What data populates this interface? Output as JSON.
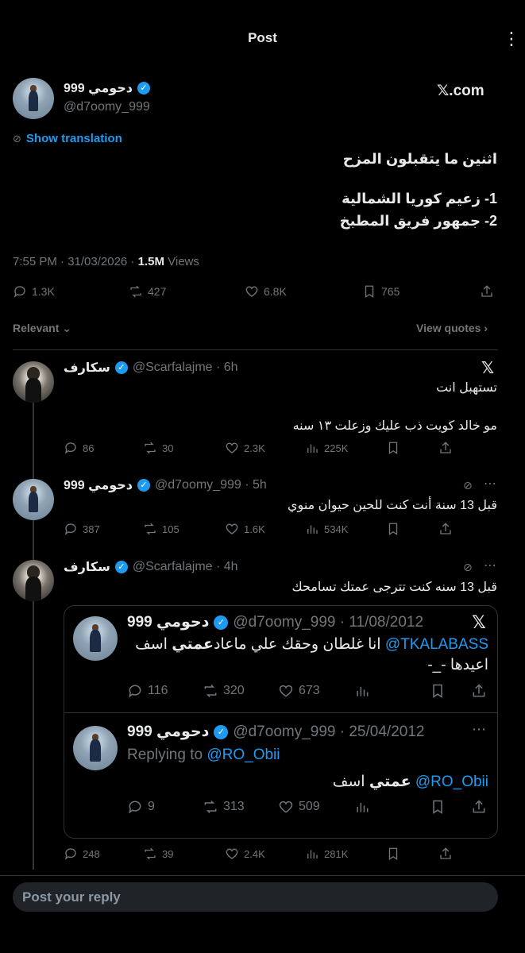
{
  "header": {
    "title": "Post",
    "more": "⋮"
  },
  "post": {
    "name": "دحومي 999",
    "handle": "@d7oomy_999",
    "source": "𝕏.com",
    "show_translation": "Show translation",
    "line1": "اثنين ما يتقبلون المزح",
    "line2": "1- زعيم كوريا الشمالية",
    "line3": "2- جمهور فريق المطبخ",
    "time": "7:55 PM · 31/03/2026 · ",
    "views_count": "1.5M",
    "views_label": " Views",
    "stats": {
      "replies": "1.3K",
      "reposts": "427",
      "likes": "6.8K",
      "bookmarks": "765"
    }
  },
  "filter": {
    "relevant": "Relevant",
    "view_quotes": "View quotes"
  },
  "replies": [
    {
      "name": "سكارف",
      "handle": "@Scarfalajme · 6h",
      "line1": "تستهبل انت",
      "line2": "مو خالد كويت ذب عليك وزعلت ١٣ سنه",
      "stats": {
        "replies": "86",
        "reposts": "30",
        "likes": "2.3K",
        "views": "225K"
      }
    },
    {
      "name": "دحومي 999",
      "handle": "@d7oomy_999 · 5h",
      "line1": "قبل 13 سنة أنت كنت للحين حيوان منوي",
      "stats": {
        "replies": "387",
        "reposts": "105",
        "likes": "1.6K",
        "views": "534K"
      }
    },
    {
      "name": "سكارف",
      "handle": "@Scarfalajme · 4h",
      "line1": "قبل 13 سنه كنت تترجى عمتك تسامحك",
      "stats": {
        "replies": "248",
        "reposts": "39",
        "likes": "2.4K",
        "views": "281K"
      }
    }
  ],
  "quote1": {
    "name": "دحومي 999",
    "handle": "@d7oomy_999 · 11/08/2012",
    "mention": "@TKALABASS",
    "text_a": " اسف ",
    "text_b": "عمتي",
    "text_c": " انا غلطان وحقك علي ماعاد",
    "line2": "اعيدها -_-",
    "stats": {
      "replies": "116",
      "reposts": "320",
      "likes": "673"
    }
  },
  "quote2": {
    "name": "دحومي 999",
    "handle": "@d7oomy_999 · 25/04/2012",
    "replying_to": "Replying to ",
    "replying_handle": "@RO_Obii",
    "mention": "@RO_Obii",
    "text_a": " اسف ",
    "text_b": "عمتي",
    "stats": {
      "replies": "9",
      "reposts": "313",
      "likes": "509"
    }
  },
  "composer": {
    "placeholder": "Post your reply"
  },
  "colors": {
    "accent": "#1d9bf0",
    "muted": "#71767b",
    "background": "#000000"
  }
}
